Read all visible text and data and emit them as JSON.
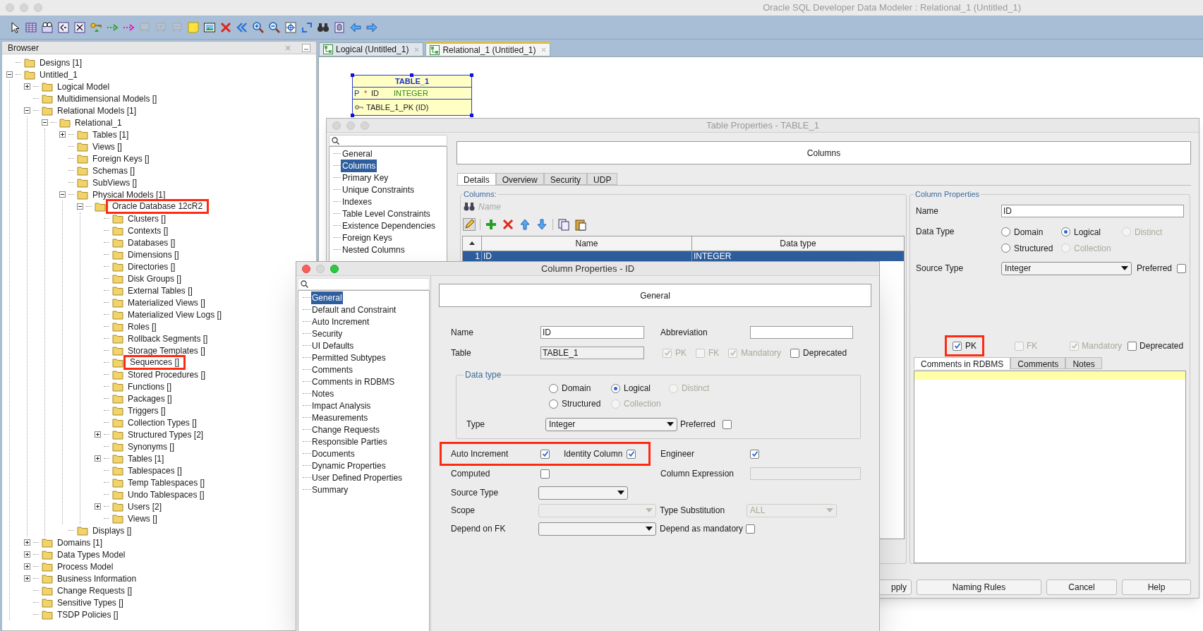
{
  "window": {
    "title": "Oracle SQL Developer Data Modeler : Relational_1 (Untitled_1)",
    "active": false
  },
  "toolbar": [
    {
      "disabled": false
    },
    {
      "disabled": false
    },
    {
      "disabled": false
    },
    {
      "disabled": false
    },
    {
      "disabled": false
    },
    {
      "disabled": false
    },
    {
      "disabled": false
    },
    {
      "disabled": false
    },
    {
      "disabled": true
    },
    {
      "disabled": true
    },
    {
      "disabled": true
    },
    {
      "disabled": false
    },
    {
      "disabled": false
    },
    {
      "disabled": false
    },
    {
      "disabled": false
    },
    {
      "disabled": false
    },
    {
      "disabled": false
    },
    {
      "disabled": false
    },
    {
      "disabled": false
    },
    {
      "disabled": false
    },
    {
      "disabled": false
    },
    {
      "disabled": false
    },
    {
      "disabled": false
    }
  ],
  "browser": {
    "title": "Browser",
    "tree": [
      {
        "label": "Designs [1]",
        "kind": "leaf",
        "highlighted": false
      },
      {
        "label": "Untitled_1",
        "kind": "branch",
        "expanded": true,
        "highlighted": false,
        "children": [
          {
            "label": "Logical Model",
            "kind": "branch",
            "expanded": false,
            "highlighted": false
          },
          {
            "label": "Multidimensional Models []",
            "kind": "leaf",
            "highlighted": false
          },
          {
            "label": "Relational Models [1]",
            "kind": "branch",
            "expanded": true,
            "highlighted": false,
            "children": [
              {
                "label": "Relational_1",
                "kind": "branch",
                "expanded": true,
                "highlighted": false,
                "children": [
                  {
                    "label": "Tables [1]",
                    "kind": "branch",
                    "expanded": false,
                    "highlighted": false
                  },
                  {
                    "label": "Views []",
                    "kind": "leaf",
                    "highlighted": false
                  },
                  {
                    "label": "Foreign Keys []",
                    "kind": "leaf",
                    "highlighted": false
                  },
                  {
                    "label": "Schemas []",
                    "kind": "leaf",
                    "highlighted": false
                  },
                  {
                    "label": "SubViews []",
                    "kind": "leaf",
                    "highlighted": false
                  },
                  {
                    "label": "Physical Models [1]",
                    "kind": "branch",
                    "expanded": true,
                    "highlighted": false,
                    "children": [
                      {
                        "label": "Oracle Database 12cR2",
                        "kind": "branch",
                        "expanded": true,
                        "highlighted": true,
                        "children": [
                          {
                            "label": "Clusters []",
                            "kind": "leaf",
                            "highlighted": false
                          },
                          {
                            "label": "Contexts []",
                            "kind": "leaf",
                            "highlighted": false
                          },
                          {
                            "label": "Databases []",
                            "kind": "leaf",
                            "highlighted": false
                          },
                          {
                            "label": "Dimensions []",
                            "kind": "leaf",
                            "highlighted": false
                          },
                          {
                            "label": "Directories []",
                            "kind": "leaf",
                            "highlighted": false
                          },
                          {
                            "label": "Disk Groups []",
                            "kind": "leaf",
                            "highlighted": false
                          },
                          {
                            "label": "External Tables []",
                            "kind": "leaf",
                            "highlighted": false
                          },
                          {
                            "label": "Materialized Views []",
                            "kind": "leaf",
                            "highlighted": false
                          },
                          {
                            "label": "Materialized View Logs []",
                            "kind": "leaf",
                            "highlighted": false
                          },
                          {
                            "label": "Roles []",
                            "kind": "leaf",
                            "highlighted": false
                          },
                          {
                            "label": "Rollback Segments []",
                            "kind": "leaf",
                            "highlighted": false
                          },
                          {
                            "label": "Storage Templates []",
                            "kind": "leaf",
                            "highlighted": false
                          },
                          {
                            "label": "Sequences []",
                            "kind": "leaf",
                            "highlighted": true
                          },
                          {
                            "label": "Stored Procedures []",
                            "kind": "leaf",
                            "highlighted": false
                          },
                          {
                            "label": "Functions []",
                            "kind": "leaf",
                            "highlighted": false
                          },
                          {
                            "label": "Packages []",
                            "kind": "leaf",
                            "highlighted": false
                          },
                          {
                            "label": "Triggers []",
                            "kind": "leaf",
                            "highlighted": false
                          },
                          {
                            "label": "Collection Types []",
                            "kind": "leaf",
                            "highlighted": false
                          },
                          {
                            "label": "Structured Types [2]",
                            "kind": "branch",
                            "expanded": false,
                            "highlighted": false
                          },
                          {
                            "label": "Synonyms []",
                            "kind": "leaf",
                            "highlighted": false
                          },
                          {
                            "label": "Tables [1]",
                            "kind": "branch",
                            "expanded": false,
                            "highlighted": false
                          },
                          {
                            "label": "Tablespaces []",
                            "kind": "leaf",
                            "highlighted": false
                          },
                          {
                            "label": "Temp Tablespaces []",
                            "kind": "leaf",
                            "highlighted": false
                          },
                          {
                            "label": "Undo Tablespaces []",
                            "kind": "leaf",
                            "highlighted": false
                          },
                          {
                            "label": "Users [2]",
                            "kind": "branch",
                            "expanded": false,
                            "highlighted": false
                          },
                          {
                            "label": "Views []",
                            "kind": "leaf",
                            "highlighted": false
                          }
                        ]
                      }
                    ]
                  },
                  {
                    "label": "Displays []",
                    "kind": "leaf",
                    "highlighted": false
                  }
                ]
              }
            ]
          },
          {
            "label": "Domains [1]",
            "kind": "branch",
            "expanded": false,
            "highlighted": false
          },
          {
            "label": "Data Types Model",
            "kind": "branch",
            "expanded": false,
            "highlighted": false
          },
          {
            "label": "Process Model",
            "kind": "branch",
            "expanded": false,
            "highlighted": false
          },
          {
            "label": "Business Information",
            "kind": "branch",
            "expanded": false,
            "highlighted": false
          },
          {
            "label": "Change Requests []",
            "kind": "leaf",
            "highlighted": false
          },
          {
            "label": "Sensitive Types []",
            "kind": "leaf",
            "highlighted": false
          },
          {
            "label": "TSDP Policies []",
            "kind": "leaf",
            "highlighted": false
          }
        ]
      }
    ]
  },
  "editor_tabs": [
    {
      "label": "Logical (Untitled_1)",
      "selected": false
    },
    {
      "label": "Relational_1 (Untitled_1)",
      "selected": true
    }
  ],
  "diagram": {
    "table": {
      "name": "TABLE_1",
      "columns": [
        {
          "key": "P",
          "mandatory": "*",
          "name": "ID",
          "type": "INTEGER"
        }
      ],
      "keys": [
        "TABLE_1_PK (ID)"
      ]
    }
  },
  "table_properties": {
    "title": "Table Properties - TABLE_1",
    "active": false,
    "nav": [
      {
        "label": "General",
        "selected": false
      },
      {
        "label": "Columns",
        "selected": true
      },
      {
        "label": "Primary Key",
        "selected": false
      },
      {
        "label": "Unique Constraints",
        "selected": false
      },
      {
        "label": "Indexes",
        "selected": false
      },
      {
        "label": "Table Level Constraints",
        "selected": false
      },
      {
        "label": "Existence Dependencies",
        "selected": false
      },
      {
        "label": "Foreign Keys",
        "selected": false
      },
      {
        "label": "Nested Columns",
        "selected": false
      }
    ],
    "header": "Columns",
    "tabs": [
      {
        "label": "Details",
        "selected": true
      },
      {
        "label": "Overview",
        "selected": false
      },
      {
        "label": "Security",
        "selected": false
      },
      {
        "label": "UDP",
        "selected": false
      }
    ],
    "columns_panel": {
      "legend": "Columns:",
      "filter_placeholder": "Name",
      "headers": [
        "Name",
        "Data type"
      ],
      "rows": [
        {
          "index": "1",
          "name": "ID",
          "type": "INTEGER",
          "selected": true
        }
      ]
    },
    "column_properties": {
      "legend": "Column Properties",
      "name_label": "Name",
      "name": "ID",
      "data_type_label": "Data Type",
      "radios": [
        {
          "label": "Domain",
          "selected": false,
          "disabled": false
        },
        {
          "label": "Logical",
          "selected": true,
          "disabled": false
        },
        {
          "label": "Distinct",
          "selected": false,
          "disabled": true
        },
        {
          "label": "Structured",
          "selected": false,
          "disabled": false
        },
        {
          "label": "Collection",
          "selected": false,
          "disabled": true
        }
      ],
      "source_type_label": "Source Type",
      "source_type": "Integer",
      "preferred": {
        "label": "Preferred",
        "checked": false
      },
      "flags": [
        {
          "label": "PK",
          "checked": true,
          "disabled": false,
          "highlighted": true
        },
        {
          "label": "FK",
          "checked": false,
          "disabled": true,
          "highlighted": false
        },
        {
          "label": "Mandatory",
          "checked": true,
          "disabled": true,
          "highlighted": false
        },
        {
          "label": "Deprecated",
          "checked": false,
          "disabled": false,
          "highlighted": false
        }
      ],
      "comment_tabs": [
        {
          "label": "Comments in RDBMS",
          "selected": true
        },
        {
          "label": "Comments",
          "selected": false
        },
        {
          "label": "Notes",
          "selected": false
        }
      ]
    },
    "buttons": [
      "pply",
      "Naming Rules",
      "Cancel",
      "Help"
    ]
  },
  "column_dialog": {
    "title": "Column Properties - ID",
    "active": true,
    "nav": [
      {
        "label": "General",
        "selected": true
      },
      {
        "label": "Default and Constraint",
        "selected": false
      },
      {
        "label": "Auto Increment",
        "selected": false
      },
      {
        "label": "Security",
        "selected": false
      },
      {
        "label": "UI Defaults",
        "selected": false
      },
      {
        "label": "Permitted Subtypes",
        "selected": false
      },
      {
        "label": "Comments",
        "selected": false
      },
      {
        "label": "Comments in RDBMS",
        "selected": false
      },
      {
        "label": "Notes",
        "selected": false
      },
      {
        "label": "Impact Analysis",
        "selected": false
      },
      {
        "label": "Measurements",
        "selected": false
      },
      {
        "label": "Change Requests",
        "selected": false
      },
      {
        "label": "Responsible Parties",
        "selected": false
      },
      {
        "label": "Documents",
        "selected": false
      },
      {
        "label": "Dynamic Properties",
        "selected": false
      },
      {
        "label": "User Defined Properties",
        "selected": false
      },
      {
        "label": "Summary",
        "selected": false
      }
    ],
    "header": "General",
    "name_label": "Name",
    "name": "ID",
    "abbreviation_label": "Abbreviation",
    "table_label": "Table",
    "table": "TABLE_1",
    "flags": [
      {
        "label": "PK",
        "checked": true,
        "disabled": true
      },
      {
        "label": "FK",
        "checked": false,
        "disabled": true
      },
      {
        "label": "Mandatory",
        "checked": true,
        "disabled": true
      },
      {
        "label": "Deprecated",
        "checked": false,
        "disabled": false
      }
    ],
    "data_type": {
      "legend": "Data type",
      "radios": [
        {
          "label": "Domain",
          "selected": false,
          "disabled": false
        },
        {
          "label": "Logical",
          "selected": true,
          "disabled": false
        },
        {
          "label": "Distinct",
          "selected": false,
          "disabled": true
        },
        {
          "label": "Structured",
          "selected": false,
          "disabled": false
        },
        {
          "label": "Collection",
          "selected": false,
          "disabled": true
        }
      ],
      "type_label": "Type",
      "type": "Integer",
      "preferred": {
        "label": "Preferred",
        "checked": false
      }
    },
    "identity": {
      "highlighted": true,
      "items": [
        {
          "label": "Auto Increment",
          "checked": true
        },
        {
          "label": "Identity Column",
          "checked": true
        }
      ]
    },
    "engineer": {
      "label": "Engineer",
      "checked": true
    },
    "computed": {
      "label": "Computed",
      "checked": false
    },
    "column_expression_label": "Column Expression",
    "source_type_label": "Source Type",
    "scope_label": "Scope",
    "type_substitution_label": "Type Substitution",
    "type_substitution": "ALL",
    "depend_on_fk_label": "Depend on FK",
    "depend_as_mandatory": {
      "label": "Depend as mandatory",
      "checked": false
    }
  }
}
